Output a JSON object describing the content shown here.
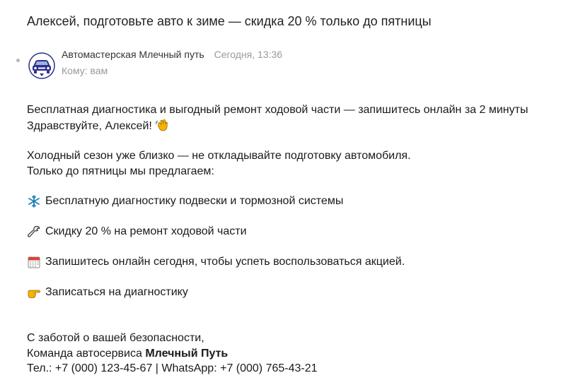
{
  "email": {
    "subject": "Алексей, подготовьте авто к зиме — скидка 20 % только до пятницы",
    "sender": "Автомастерская Млечный путь",
    "date": "Сегодня, 13:36",
    "to": "Кому: вам",
    "avatar_icon": "car-logo-icon"
  },
  "body": {
    "headline": "Бесплатная диагностика и выгодный ремонт ходовой части — запишитесь онлайн за 2 минуты",
    "greeting": "Здравствуйте, Алексей!",
    "intro_line1": "Холодный сезон уже близко — не откладывайте подготовку автомобиля.",
    "intro_line2": "Только до пятницы мы предлагаем:",
    "items": [
      {
        "icon": "snowflake-icon",
        "text": "Бесплатную диагностику подвески и тормозной системы"
      },
      {
        "icon": "wrench-icon",
        "text": "Скидку 20 % на ремонт ходовой части"
      },
      {
        "icon": "calendar-icon",
        "text": "Запишитесь онлайн сегодня, чтобы успеть воспользоваться акцией."
      },
      {
        "icon": "pointing-hand-icon",
        "text": "Записаться на диагностику"
      }
    ],
    "signature": {
      "line1": "С заботой о вашей безопасности,",
      "line2_prefix": "Команда автосервиса ",
      "line2_brand": "Млечный Путь",
      "line3": "Тел.: +7 (000) 123-45-67 | WhatsApp: +7 (000) 765-43-21"
    }
  },
  "colors": {
    "subject": "#222222",
    "meta": "#999999",
    "avatar": "#2a2f8f"
  }
}
